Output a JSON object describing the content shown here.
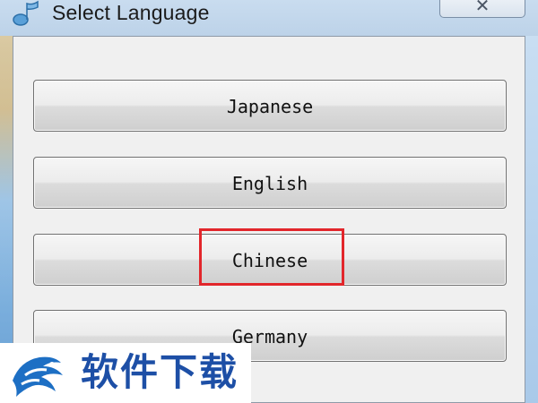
{
  "window": {
    "title": "Select Language",
    "close_glyph": "✕",
    "app_icon": "music-note-icon"
  },
  "languages": [
    {
      "label": "Japanese"
    },
    {
      "label": "English"
    },
    {
      "label": "Chinese",
      "highlighted": true
    },
    {
      "label": "Germany"
    }
  ],
  "watermark": {
    "text": "软件下载",
    "logo_icon": "dragon-logo-icon"
  },
  "colors": {
    "highlight_border": "#e2262b",
    "watermark_text": "#1d4fa6",
    "client_background": "#f0f0f0"
  }
}
